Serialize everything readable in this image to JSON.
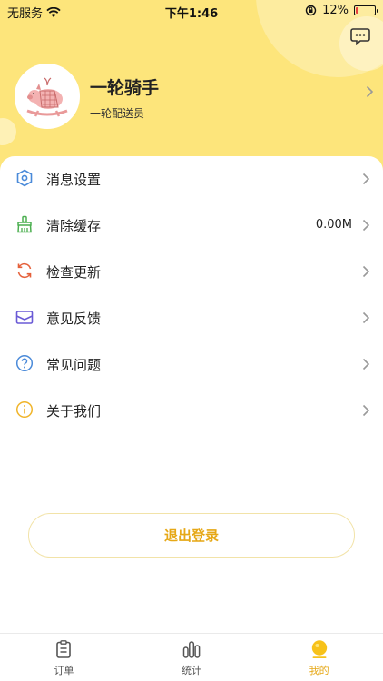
{
  "status_bar": {
    "carrier": "无服务",
    "time": "下午1:46",
    "battery": "12%"
  },
  "profile": {
    "name": "一轮骑手",
    "role": "一轮配送员"
  },
  "menu": [
    {
      "label": "消息设置",
      "value": "",
      "icon": "hexagon-settings-icon"
    },
    {
      "label": "清除缓存",
      "value": "0.00M",
      "icon": "broom-icon"
    },
    {
      "label": "检查更新",
      "value": "",
      "icon": "refresh-icon"
    },
    {
      "label": "意见反馈",
      "value": "",
      "icon": "mail-icon"
    },
    {
      "label": "常见问题",
      "value": "",
      "icon": "question-icon"
    },
    {
      "label": "关于我们",
      "value": "",
      "icon": "info-icon"
    }
  ],
  "logout_label": "退出登录",
  "tabs": [
    {
      "label": "订单",
      "icon": "clipboard-icon",
      "active": false
    },
    {
      "label": "统计",
      "icon": "bar-chart-icon",
      "active": false
    },
    {
      "label": "我的",
      "icon": "profile-icon",
      "active": true
    }
  ],
  "colors": {
    "header": "#fde57b",
    "accent": "#e6a817",
    "battery_low": "#e8423f"
  }
}
